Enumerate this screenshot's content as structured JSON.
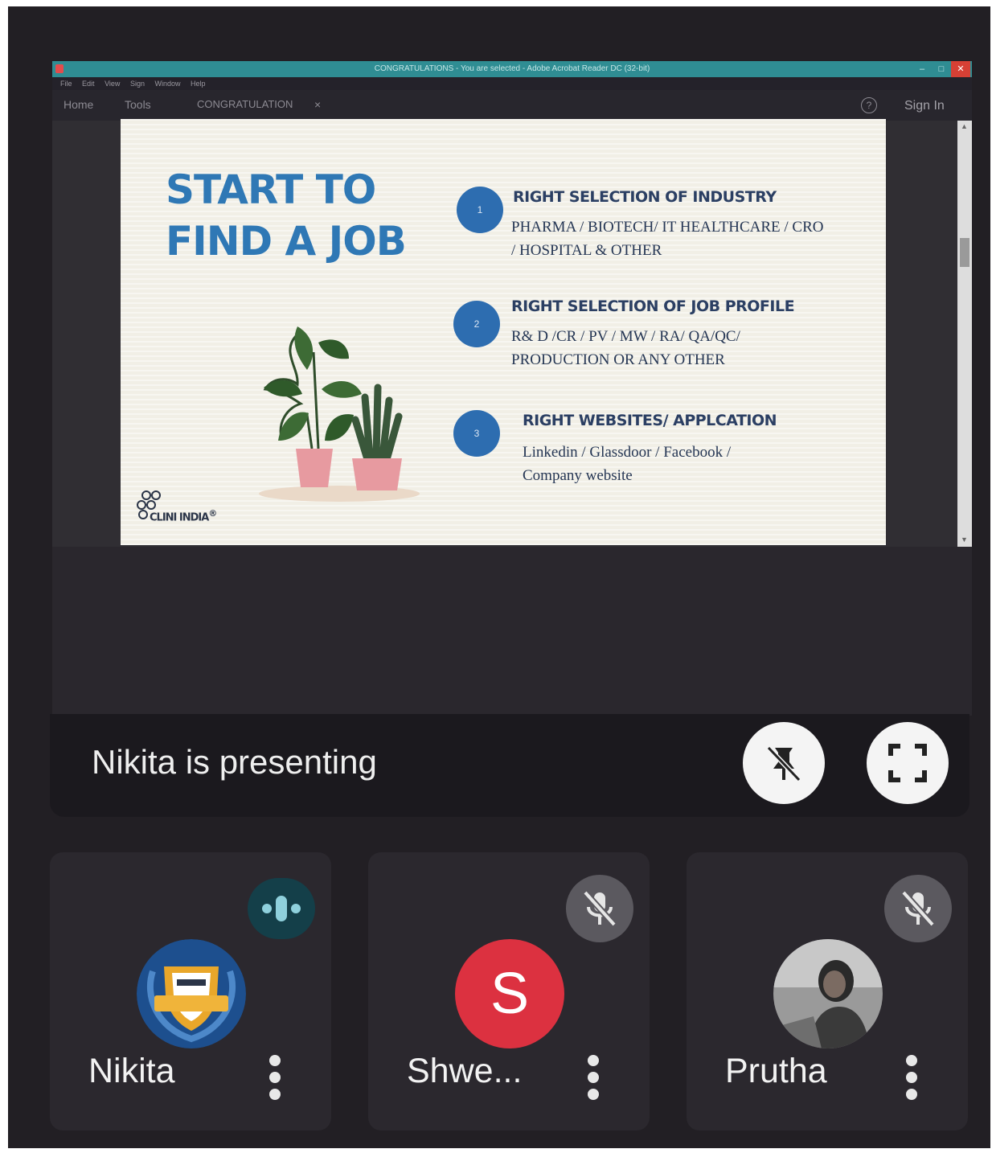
{
  "acrobat": {
    "window_title": "CONGRATULATIONS - You are selected - Adobe Acrobat Reader DC (32-bit)",
    "window_minimize": "–",
    "window_maximize": "□",
    "window_close": "✕",
    "menu": [
      "File",
      "Edit",
      "View",
      "Sign",
      "Window",
      "Help"
    ],
    "tabs": {
      "home": "Home",
      "tools": "Tools",
      "document": "CONGRATULATION",
      "close": "×"
    },
    "help_label": "?",
    "sign_in": "Sign In",
    "scroll_up": "▲",
    "scroll_down": "▼"
  },
  "slide": {
    "title_line1": "START TO",
    "title_line2": "FIND A JOB",
    "items": [
      {
        "num": "1",
        "heading": "RIGHT SELECTION OF INDUSTRY",
        "line1": "PHARMA / BIOTECH/ IT HEALTHCARE / CRO",
        "line2": "/ HOSPITAL & OTHER"
      },
      {
        "num": "2",
        "heading": "RIGHT SELECTION OF JOB PROFILE",
        "line1": "R& D /CR / PV / MW / RA/ QA/QC/",
        "line2": "PRODUCTION OR ANY OTHER"
      },
      {
        "num": "3",
        "heading": "RIGHT WEBSITES/ APPLCATION",
        "line1": "Linkedin / Glassdoor / Facebook /",
        "line2": "Company website"
      }
    ],
    "logo_text": "CLINI INDIA",
    "logo_mark": "®"
  },
  "meet": {
    "presenting_text": "Nikita is presenting",
    "participants": [
      {
        "name": "Nikita",
        "status": "speaking"
      },
      {
        "name": "Shwe...",
        "initial": "S",
        "status": "muted"
      },
      {
        "name": "Prutha",
        "status": "muted"
      }
    ]
  },
  "colors": {
    "slide_title": "#2f78b5",
    "number_circle": "#2d6db0",
    "avatar_s": "#dc3140",
    "titlebar": "#2f8d93"
  },
  "icons": [
    "unpin-icon",
    "fullscreen-icon",
    "mic-off-icon",
    "audio-level-icon",
    "more-options-icon",
    "help-icon",
    "plant-illustration",
    "clini-india-logo"
  ]
}
